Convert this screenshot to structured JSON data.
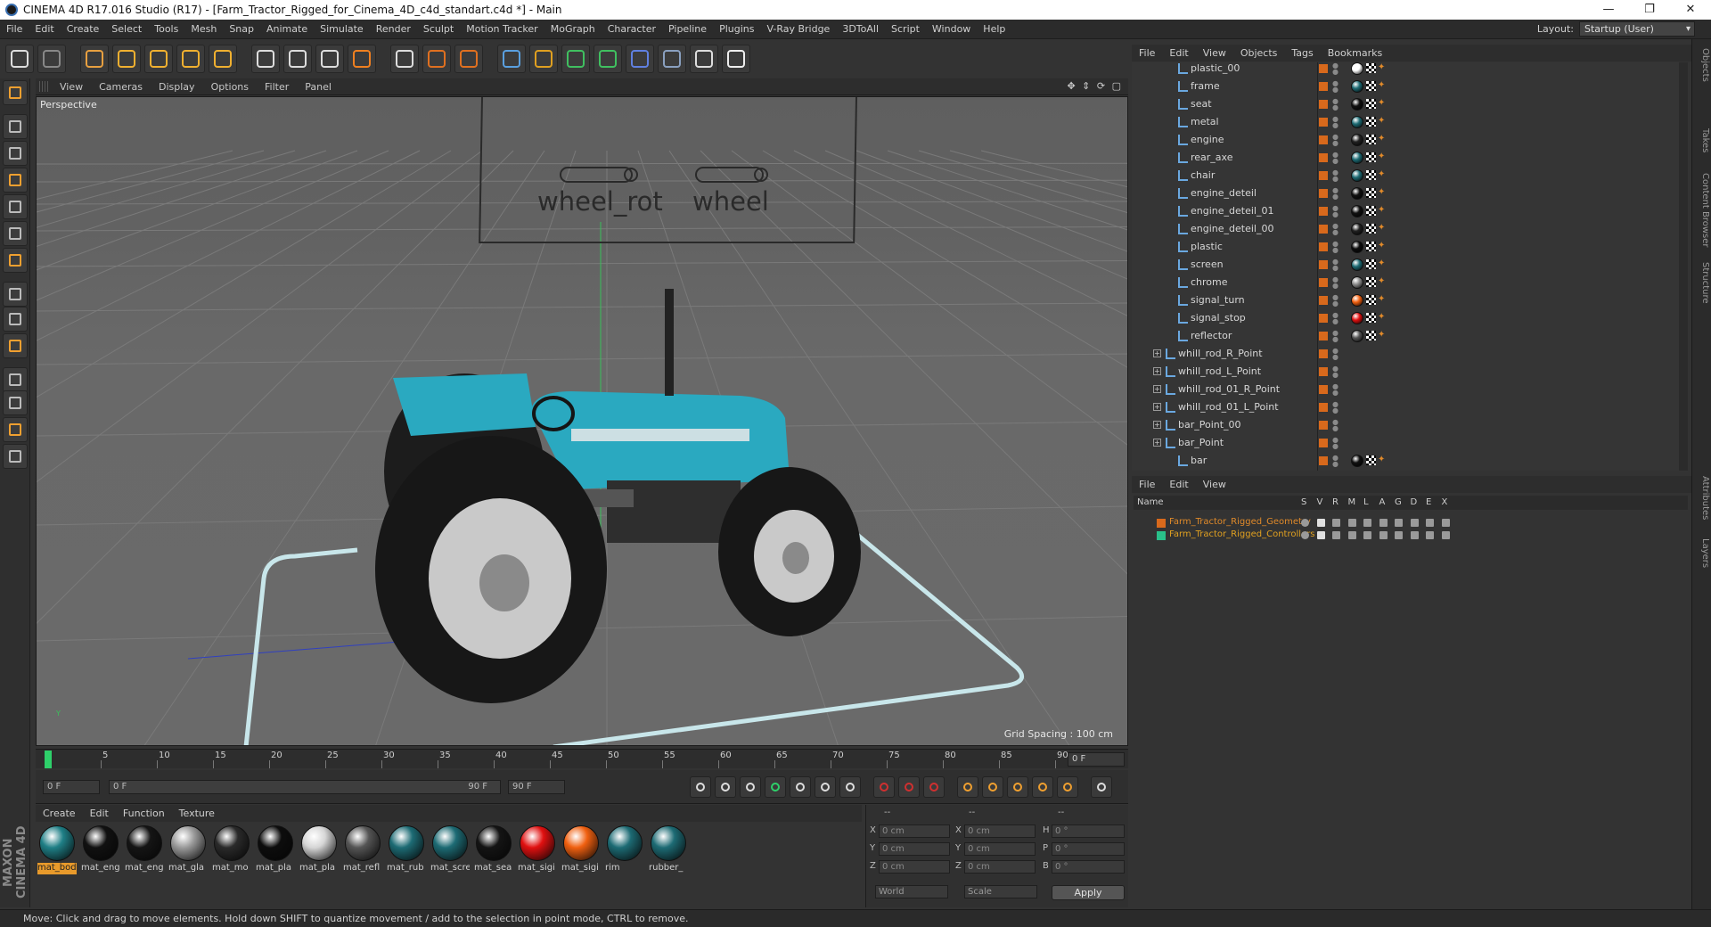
{
  "window": {
    "title": "CINEMA 4D R17.016 Studio (R17) - [Farm_Tractor_Rigged_for_Cinema_4D_c4d_standart.c4d *] - Main",
    "minimize": "—",
    "maximize": "❐",
    "close": "✕"
  },
  "menubar": {
    "items": [
      "File",
      "Edit",
      "Create",
      "Select",
      "Tools",
      "Mesh",
      "Snap",
      "Animate",
      "Simulate",
      "Render",
      "Sculpt",
      "Motion Tracker",
      "MoGraph",
      "Character",
      "Pipeline",
      "Plugins",
      "V-Ray Bridge",
      "3DToAll",
      "Script",
      "Window",
      "Help"
    ],
    "layout_label": "Layout:",
    "layout_value": "Startup (User)"
  },
  "viewport": {
    "menu": [
      "View",
      "Cameras",
      "Display",
      "Options",
      "Filter",
      "Panel"
    ],
    "label": "Perspective",
    "grid_spacing": "Grid Spacing : 100 cm",
    "controller_labels": [
      "wheel_rot",
      "wheel"
    ],
    "axis_y": "Y"
  },
  "timeline": {
    "ticks": [
      "0",
      "5",
      "10",
      "15",
      "20",
      "25",
      "30",
      "35",
      "40",
      "45",
      "50",
      "55",
      "60",
      "65",
      "70",
      "75",
      "80",
      "85",
      "90"
    ],
    "current_frame": "0 F"
  },
  "transport": {
    "start_field": "0 F",
    "range_start": "0 F",
    "range_end": "90 F",
    "end_field": "90 F"
  },
  "materials": {
    "menu": [
      "Create",
      "Edit",
      "Function",
      "Texture"
    ],
    "items": [
      {
        "label": "mat_bod",
        "color": "#1f7f86",
        "selected": true
      },
      {
        "label": "mat_eng",
        "color": "#111111"
      },
      {
        "label": "mat_eng",
        "color": "#151515"
      },
      {
        "label": "mat_gla",
        "color": "#9a9a9a"
      },
      {
        "label": "mat_mo",
        "color": "#2a2a2a"
      },
      {
        "label": "mat_pla",
        "color": "#0d0d0d"
      },
      {
        "label": "mat_pla",
        "color": "#d6d6d6"
      },
      {
        "label": "mat_refl",
        "color": "#555555"
      },
      {
        "label": "mat_rub",
        "color": "#1d6b74"
      },
      {
        "label": "mat_scre",
        "color": "#1d6b74"
      },
      {
        "label": "mat_sea",
        "color": "#141414"
      },
      {
        "label": "mat_sigi",
        "color": "#e01010"
      },
      {
        "label": "mat_sigi",
        "color": "#f06010"
      },
      {
        "label": "rim",
        "color": "#1d6b74"
      },
      {
        "label": "rubber_",
        "color": "#1d6b74"
      }
    ]
  },
  "coordinates": {
    "headers": [
      "--",
      "--",
      "--"
    ],
    "rows": [
      {
        "a": "X",
        "av": "0 cm",
        "b": "X",
        "bv": "0 cm",
        "c": "H",
        "cv": "0 °"
      },
      {
        "a": "Y",
        "av": "0 cm",
        "b": "Y",
        "bv": "0 cm",
        "c": "P",
        "cv": "0 °"
      },
      {
        "a": "Z",
        "av": "0 cm",
        "b": "Z",
        "bv": "0 cm",
        "c": "B",
        "cv": "0 °"
      }
    ],
    "mode1": "World",
    "mode2": "Scale",
    "apply": "Apply"
  },
  "objects": {
    "menu": [
      "File",
      "Edit",
      "View",
      "Objects",
      "Tags",
      "Bookmarks"
    ],
    "rows": [
      {
        "name": "plastic_00",
        "indent": 2,
        "kind": "poly",
        "tag": "#ffffff"
      },
      {
        "name": "frame",
        "indent": 2,
        "kind": "poly",
        "tag": "#1d6b74"
      },
      {
        "name": "seat",
        "indent": 2,
        "kind": "poly",
        "tag": "#111111"
      },
      {
        "name": "metal",
        "indent": 2,
        "kind": "poly",
        "tag": "#1d6b74"
      },
      {
        "name": "engine",
        "indent": 2,
        "kind": "poly",
        "tag": "#222222"
      },
      {
        "name": "rear_axe",
        "indent": 2,
        "kind": "poly",
        "tag": "#1d6b74"
      },
      {
        "name": "chair",
        "indent": 2,
        "kind": "poly",
        "tag": "#1d6b74"
      },
      {
        "name": "engine_deteil",
        "indent": 2,
        "kind": "poly",
        "tag": "#111111"
      },
      {
        "name": "engine_deteil_01",
        "indent": 2,
        "kind": "poly",
        "tag": "#111111"
      },
      {
        "name": "engine_deteil_00",
        "indent": 2,
        "kind": "poly",
        "tag": "#222222"
      },
      {
        "name": "plastic",
        "indent": 2,
        "kind": "poly",
        "tag": "#0d0d0d"
      },
      {
        "name": "screen",
        "indent": 2,
        "kind": "poly",
        "tag": "#1d6b74"
      },
      {
        "name": "chrome",
        "indent": 2,
        "kind": "poly",
        "tag": "#8a8a8a"
      },
      {
        "name": "signal_turn",
        "indent": 2,
        "kind": "poly",
        "tag": "#f06010"
      },
      {
        "name": "signal_stop",
        "indent": 2,
        "kind": "poly",
        "tag": "#e01010"
      },
      {
        "name": "reflector",
        "indent": 2,
        "kind": "poly",
        "tag": "#555555"
      },
      {
        "name": "whill_rod_R_Point",
        "indent": 1,
        "kind": "null",
        "tag": ""
      },
      {
        "name": "whill_rod_L_Point",
        "indent": 1,
        "kind": "null",
        "tag": ""
      },
      {
        "name": "whill_rod_01_R_Point",
        "indent": 1,
        "kind": "null",
        "tag": ""
      },
      {
        "name": "whill_rod_01_L_Point",
        "indent": 1,
        "kind": "null",
        "tag": ""
      },
      {
        "name": "bar_Point_00",
        "indent": 1,
        "kind": "null",
        "tag": ""
      },
      {
        "name": "bar_Point",
        "indent": 1,
        "kind": "null",
        "tag": ""
      },
      {
        "name": "bar",
        "indent": 2,
        "kind": "poly",
        "tag": "#111111"
      }
    ]
  },
  "layers": {
    "menu": [
      "File",
      "Edit",
      "View"
    ],
    "headers": [
      "Name",
      "S",
      "V",
      "R",
      "M",
      "L",
      "A",
      "G",
      "D",
      "E",
      "X"
    ],
    "rows": [
      {
        "name": "Farm_Tractor_Rigged_Geometry",
        "color": "#d8691c",
        "text_color": "#e08a2a"
      },
      {
        "name": "Farm_Tractor_Rigged_Controllers",
        "color": "#29c08a",
        "text_color": "#e0a020"
      }
    ]
  },
  "right_tabs": [
    "Objects",
    "Takes",
    "Content Browser",
    "Structure",
    "Attributes",
    "Layers"
  ],
  "brand": "MAXON CINEMA 4D",
  "status": "Move: Click and drag to move elements. Hold down SHIFT to quantize movement / add to the selection in point mode, CTRL to remove."
}
